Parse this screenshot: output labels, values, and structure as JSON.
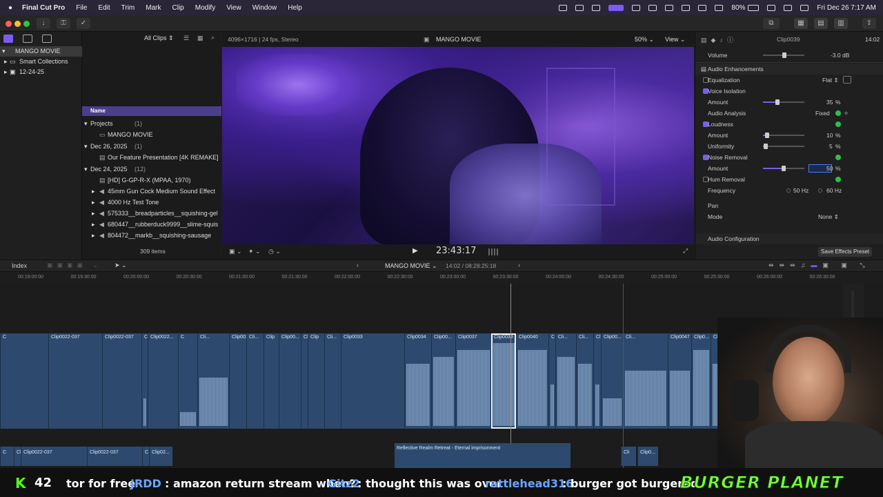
{
  "menubar": {
    "app": "Final Cut Pro",
    "menus": [
      "File",
      "Edit",
      "Trim",
      "Mark",
      "Clip",
      "Modify",
      "View",
      "Window",
      "Help"
    ],
    "battery": "80%",
    "datetime": "Fri Dec 26  7:17 AM"
  },
  "library": {
    "items": [
      "MANGO MOVIE",
      "Smart Collections",
      "12-24-25"
    ]
  },
  "browser": {
    "filter": "All Clips",
    "column_name": "Name",
    "rows": [
      {
        "label": "Projects",
        "count": "(1)",
        "type": "group"
      },
      {
        "label": "MANGO MOVIE",
        "type": "project"
      },
      {
        "label": "Dec 26, 2025",
        "count": "(1)",
        "type": "group"
      },
      {
        "label": "Our Feature Presentation [4K REMAKE]",
        "type": "clip"
      },
      {
        "label": "Dec 24, 2025",
        "count": "(12)",
        "type": "group"
      },
      {
        "label": "[HD] G-GP-R-X (MPAA, 1970)",
        "type": "clip"
      },
      {
        "label": "45mm Gun Cock Medium Sound Effect",
        "type": "audio"
      },
      {
        "label": "4000 Hz Test Tone",
        "type": "audio"
      },
      {
        "label": "575333__breadparticles__squishing-gel",
        "type": "audio"
      },
      {
        "label": "680447__rubberduck9999__slime-squis",
        "type": "audio"
      },
      {
        "label": "804472__markb__squishing-sausage",
        "type": "audio"
      }
    ],
    "item_count": "309 items"
  },
  "viewer": {
    "format": "4096×1716 | 24 fps, Stereo",
    "title": "MANGO MOVIE",
    "zoom": "50%",
    "view_label": "View",
    "timecode": "23:43:17"
  },
  "inspector": {
    "clip_name": "Clip0039",
    "duration": "14:02",
    "volume_label": "Volume",
    "volume_value": "-3.0  dB",
    "section_enh": "Audio Enhancements",
    "equalization": "Equalization",
    "eq_value": "Flat",
    "voice_isolation": "Voice Isolation",
    "amount_label": "Amount",
    "vi_amount": "35",
    "analysis_label": "Audio Analysis",
    "analysis_value": "Fixed",
    "loudness": "Loudness",
    "loud_amount": "10",
    "uniformity_label": "Uniformity",
    "uniformity_value": "5",
    "noise_removal": "Noise Removal",
    "noise_amount": "50",
    "hum_removal": "Hum Removal",
    "frequency_label": "Frequency",
    "freq_50": "50 Hz",
    "freq_60": "60 Hz",
    "pan": "Pan",
    "mode_label": "Mode",
    "mode_value": "None",
    "audio_config": "Audio Configuration",
    "save_preset": "Save Effects Preset",
    "percent": "%"
  },
  "timeline_bar": {
    "index": "Index",
    "project": "MANGO MOVIE",
    "position": "14:02 / 08:28:25:18"
  },
  "ruler": [
    "00:19:00:00",
    "00:19:30:00",
    "00:20:00:00",
    "00:20:30:00",
    "00:21:00:00",
    "00:21:30:00",
    "00:22:00:00",
    "00:22:30:00",
    "00:23:00:00",
    "00:23:30:00",
    "00:24:00:00",
    "00:24:30:00",
    "00:25:00:00",
    "00:25:30:00",
    "00:26:00:00",
    "00:26:30:00"
  ],
  "clips": [
    "C",
    "Clip0022-037",
    "Clip0022-037",
    "C",
    "Clip0022...",
    "C",
    "Cli...",
    "Clip0029",
    "Cli...",
    "Clip",
    "Clip00...",
    "Cli...",
    "Clip",
    "Cli...",
    "Clip0033",
    "Clip0034",
    "Clip00...",
    "Clip0037",
    "Clip0039",
    "Clip0040",
    "C",
    "Cli...",
    "Cli...",
    "Cli...",
    "Clip00...",
    "Cli...",
    "Clip0047",
    "Clip0...",
    "Cli...",
    "Clip00..."
  ],
  "low_clips": [
    "C",
    "Cli",
    "Clip0022-037",
    "Clip0022-037",
    "C",
    "Clip02..."
  ],
  "music_clip": "Reflective Realm Retreat - Eternal imprisonment",
  "low_right_clips": [
    "Cli",
    "Clip0..."
  ],
  "chat": {
    "k_count": "42",
    "msg0": "tor for free",
    "user1": "JRDD",
    "msg1": ": amazon return stream when?",
    "user2": "Gitz2",
    "msg2": ": thought this was over",
    "user3": "rattlehead316",
    "msg3": ": burger got burgered",
    "brand": "BURGER PLANET"
  },
  "colors": {
    "accent": "#7b5cf0",
    "clip": "#2d4a6e",
    "green": "#2fbf4a",
    "chat_user": "#4a90ff",
    "brand": "#7cff3c"
  }
}
